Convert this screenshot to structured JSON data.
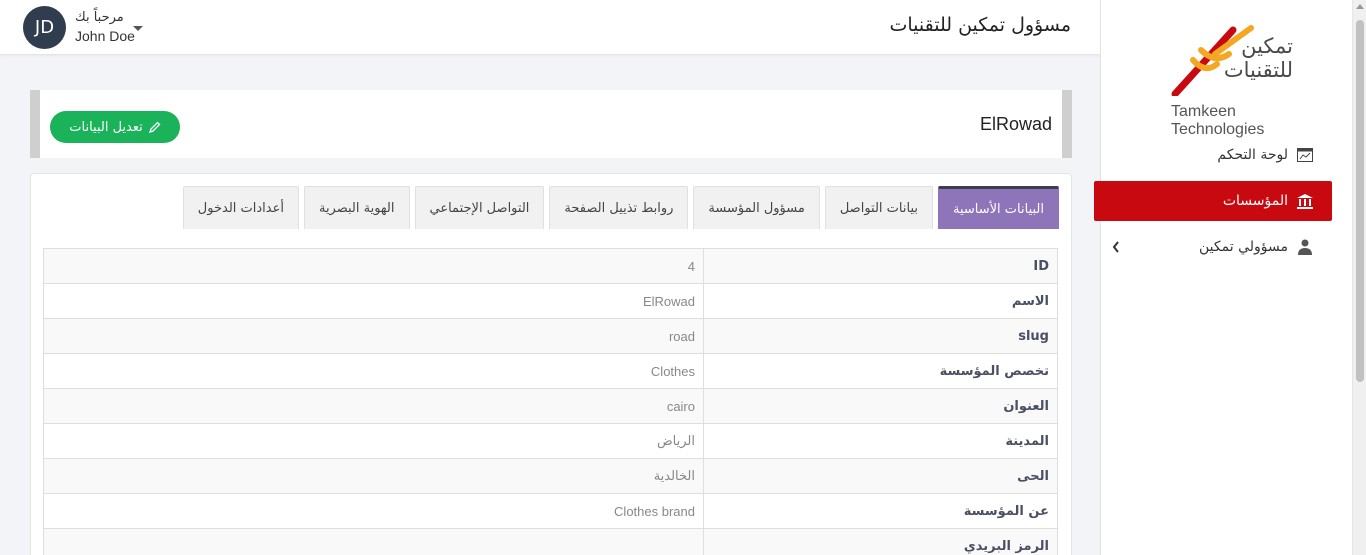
{
  "topbar": {
    "page_title": "مسؤول تمكين للتقنيات",
    "avatar_initials": "JD",
    "welcome_label": "مرحباً بك",
    "user_name": "John Doe"
  },
  "sidebar": {
    "logo_ar_line1": "تمكين",
    "logo_ar_line2": "للتقنيات",
    "logo_en": "Tamkeen Technologies",
    "items": [
      {
        "label": "لوحة التحكم",
        "icon": "dashboard-icon"
      },
      {
        "label": "المؤسسات",
        "icon": "institution-icon",
        "active": true
      },
      {
        "label": "مسؤولي تمكين",
        "icon": "users-icon"
      }
    ]
  },
  "header": {
    "org_name": "ElRowad",
    "edit_button": "تعديل البيانات"
  },
  "tabs": [
    "البيانات الأساسية",
    "بيانات التواصل",
    "مسؤول المؤسسة",
    "روابط تذييل الصفحة",
    "التواصل الإجتماعي",
    "الهوية البصرية",
    "أعدادات الدخول"
  ],
  "rows": [
    {
      "key": "ID",
      "value": "4"
    },
    {
      "key": "الاسم",
      "value": "ElRowad"
    },
    {
      "key": "slug",
      "value": "road"
    },
    {
      "key": "تخصص المؤسسة",
      "value": "Clothes"
    },
    {
      "key": "العنوان",
      "value": "cairo"
    },
    {
      "key": "المدينة",
      "value": "الرياض"
    },
    {
      "key": "الحى",
      "value": "الخالدية"
    },
    {
      "key": "عن المؤسسة",
      "value": "Clothes brand"
    },
    {
      "key": "الرمز البريدي",
      "value": ""
    }
  ],
  "colors": {
    "active_sidebar": "#c8090f",
    "active_tab": "#8e74b8",
    "edit_button": "#1ab35a",
    "avatar": "#2f3d4f"
  }
}
